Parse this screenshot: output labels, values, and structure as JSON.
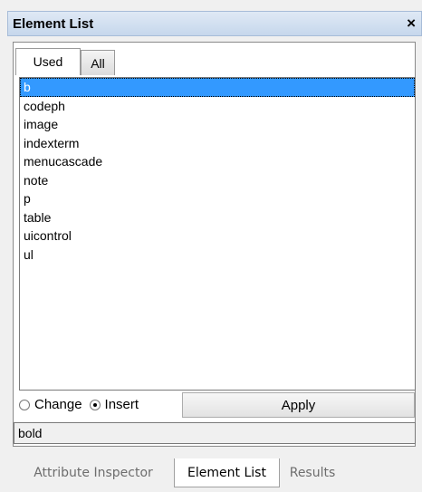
{
  "panel": {
    "title": "Element List",
    "close_label": "×"
  },
  "tabs": [
    {
      "label": "Used",
      "selected": true
    },
    {
      "label": "All",
      "selected": false
    }
  ],
  "list": {
    "items": [
      "b",
      "codeph",
      "image",
      "indexterm",
      "menucascade",
      "note",
      "p",
      "table",
      "uicontrol",
      "ul"
    ],
    "selected_index": 0
  },
  "mode": {
    "change_label": "Change",
    "insert_label": "Insert",
    "selected": "Insert"
  },
  "apply_label": "Apply",
  "status_text": "bold",
  "bottom_tabs": [
    {
      "label": "Attribute Inspector",
      "active": false
    },
    {
      "label": "Element List",
      "active": true
    },
    {
      "label": "Results",
      "active": false
    }
  ],
  "colors": {
    "selection": "#3399ff",
    "title_bar": "#c6d7ec"
  }
}
